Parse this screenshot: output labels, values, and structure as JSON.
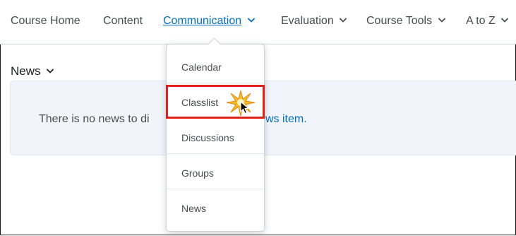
{
  "nav": {
    "items": [
      {
        "label": "Course Home",
        "has_menu": false,
        "active": false
      },
      {
        "label": "Content",
        "has_menu": false,
        "active": false
      },
      {
        "label": "Communication",
        "has_menu": true,
        "active": true
      },
      {
        "label": "Evaluation",
        "has_menu": true,
        "active": false
      },
      {
        "label": "Course Tools",
        "has_menu": true,
        "active": false
      },
      {
        "label": "A to Z",
        "has_menu": true,
        "active": false
      }
    ]
  },
  "news": {
    "title": "News",
    "empty_text_before": "There is no news to di",
    "empty_text_link": "ws item."
  },
  "dropdown": {
    "items": [
      {
        "label": "Calendar"
      },
      {
        "label": "Classlist",
        "highlighted": true
      },
      {
        "label": "Discussions"
      },
      {
        "label": "Groups"
      },
      {
        "label": "News"
      }
    ]
  },
  "colors": {
    "link": "#006fbf",
    "highlight_border": "#e0201b",
    "news_bg": "#f1f5fb"
  },
  "icons": {
    "chevron": "chevron-down-icon",
    "cursor": "mouse-pointer-icon",
    "sparkle": "click-sparkle-icon"
  }
}
